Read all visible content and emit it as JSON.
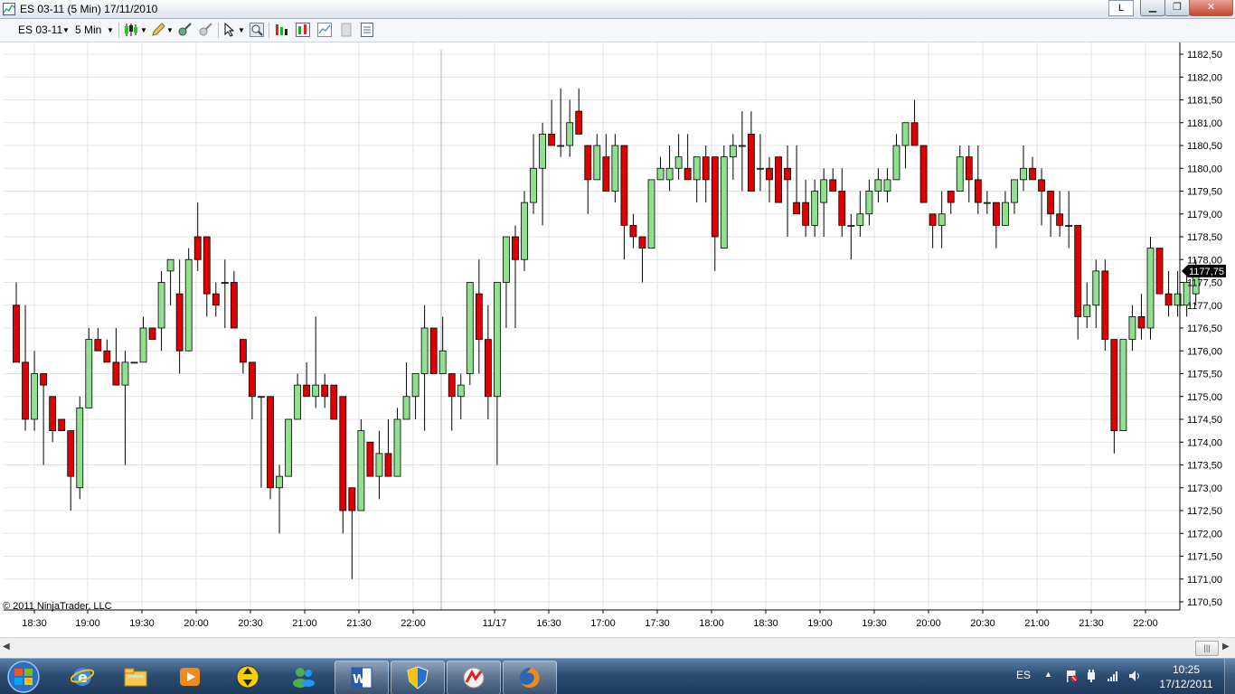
{
  "window": {
    "title": "ES 03-11 (5 Min)  17/11/2010",
    "layout_label": "L",
    "minimize": "▁",
    "maximize": "❐",
    "close": "✕"
  },
  "toolbar": {
    "instrument": "ES 03-11",
    "interval": "5 Min",
    "icons": [
      "candlestick-icon",
      "pencil-icon",
      "crosshair-icon",
      "zoom-icon",
      "pointer-icon",
      "magnifier-icon",
      "strategy-icon",
      "indicators-icon",
      "data-box-icon",
      "properties-icon",
      "templates-icon"
    ]
  },
  "chart_data": {
    "type": "candlestick",
    "instrument": "ES 03-11",
    "interval": "5 Min",
    "colors": {
      "up": "#90e090",
      "down": "#e00000",
      "grid": "#e3e3e3",
      "wick": "#000000",
      "price_marker": "#000000"
    },
    "y_range": [
      1170.25,
      1182.75
    ],
    "y_ticks": [
      "1182,50",
      "1182,00",
      "1181,50",
      "1181,00",
      "1180,50",
      "1180,00",
      "1179,50",
      "1179,00",
      "1178,50",
      "1178,00",
      "1177,50",
      "1177,00",
      "1176,50",
      "1176,00",
      "1175,50",
      "1175,00",
      "1174,50",
      "1174,00",
      "1173,50",
      "1173,00",
      "1172,50",
      "1172,00",
      "1171,50",
      "1171,00",
      "1170,50"
    ],
    "x_labels": [
      "18:30",
      "19:00",
      "19:30",
      "20:00",
      "20:30",
      "21:00",
      "21:30",
      "22:00",
      "11/17",
      "16:30",
      "17:00",
      "17:30",
      "18:00",
      "18:30",
      "19:00",
      "19:30",
      "20:00",
      "20:30",
      "21:00",
      "21:30",
      "22:00"
    ],
    "session_break_label": "11/17",
    "last_price": "1177,75",
    "copyright": "© 2011 NinjaTrader, LLC",
    "bars": [
      [
        1177.0,
        1177.5,
        1175.75,
        1175.75
      ],
      [
        1175.75,
        1177.0,
        1174.25,
        1174.5
      ],
      [
        1174.5,
        1176.0,
        1174.25,
        1175.5
      ],
      [
        1175.5,
        1175.5,
        1173.5,
        1175.25
      ],
      [
        1175.0,
        1175.0,
        1174.0,
        1174.25
      ],
      [
        1174.5,
        1174.5,
        1174.25,
        1174.25
      ],
      [
        1174.25,
        1174.25,
        1172.5,
        1173.25
      ],
      [
        1173.0,
        1175.0,
        1172.75,
        1174.75
      ],
      [
        1174.75,
        1176.5,
        1174.75,
        1176.25
      ],
      [
        1176.25,
        1176.5,
        1176.0,
        1176.0
      ],
      [
        1176.0,
        1176.25,
        1175.75,
        1175.75
      ],
      [
        1175.75,
        1176.5,
        1175.25,
        1175.25
      ],
      [
        1175.25,
        1176.0,
        1173.5,
        1175.75
      ],
      [
        1175.75,
        1175.75,
        1175.75,
        1175.75
      ],
      [
        1175.75,
        1176.75,
        1175.75,
        1176.5
      ],
      [
        1176.5,
        1176.5,
        1176.25,
        1176.25
      ],
      [
        1176.5,
        1177.75,
        1176.0,
        1177.5
      ],
      [
        1177.75,
        1178.0,
        1177.0,
        1178.0
      ],
      [
        1177.25,
        1178.0,
        1175.5,
        1176.0
      ],
      [
        1176.0,
        1178.25,
        1176.0,
        1178.0
      ],
      [
        1178.5,
        1179.25,
        1177.75,
        1178.0
      ],
      [
        1178.5,
        1178.5,
        1176.75,
        1177.25
      ],
      [
        1177.25,
        1177.5,
        1176.75,
        1177.0
      ],
      [
        1177.5,
        1178.0,
        1176.5,
        1177.5
      ],
      [
        1177.5,
        1177.75,
        1176.5,
        1176.5
      ],
      [
        1176.25,
        1176.25,
        1175.5,
        1175.75
      ],
      [
        1175.75,
        1175.75,
        1174.5,
        1175.0
      ],
      [
        1175.0,
        1175.0,
        1173.0,
        1175.0
      ],
      [
        1175.0,
        1175.0,
        1172.75,
        1173.0
      ],
      [
        1173.0,
        1173.5,
        1172.0,
        1173.25
      ],
      [
        1173.25,
        1174.5,
        1173.25,
        1174.5
      ],
      [
        1174.5,
        1175.5,
        1174.5,
        1175.25
      ],
      [
        1175.25,
        1175.75,
        1175.0,
        1175.0
      ],
      [
        1175.0,
        1176.75,
        1174.75,
        1175.25
      ],
      [
        1175.25,
        1175.5,
        1174.75,
        1175.0
      ],
      [
        1175.25,
        1175.25,
        1174.5,
        1174.5
      ],
      [
        1175.0,
        1175.0,
        1172.0,
        1172.5
      ],
      [
        1173.0,
        1173.0,
        1171.0,
        1172.5
      ],
      [
        1172.5,
        1174.5,
        1172.5,
        1174.25
      ],
      [
        1174.0,
        1174.0,
        1173.25,
        1173.25
      ],
      [
        1173.25,
        1174.25,
        1172.75,
        1173.75
      ],
      [
        1173.75,
        1174.5,
        1173.25,
        1173.25
      ],
      [
        1173.25,
        1174.75,
        1173.25,
        1174.5
      ],
      [
        1174.5,
        1175.75,
        1174.5,
        1175.0
      ],
      [
        1175.0,
        1175.5,
        1174.5,
        1175.5
      ],
      [
        1175.5,
        1177.0,
        1174.25,
        1176.5
      ],
      [
        1176.5,
        1176.5,
        1175.5,
        1175.5
      ],
      [
        1175.5,
        1176.75,
        1175.5,
        1176.0
      ],
      [
        1175.5,
        1175.5,
        1174.25,
        1175.0
      ],
      [
        1175.0,
        1175.5,
        1174.5,
        1175.25
      ],
      [
        1175.5,
        1176.5,
        1175.25,
        1177.5
      ],
      [
        1177.25,
        1178.0,
        1175.5,
        1176.25
      ],
      [
        1176.25,
        1177.0,
        1174.5,
        1175.0
      ],
      [
        1175.0,
        1177.5,
        1173.5,
        1177.5
      ],
      [
        1177.5,
        1178.5,
        1176.5,
        1178.5
      ],
      [
        1178.5,
        1178.75,
        1176.5,
        1178.0
      ],
      [
        1178.0,
        1179.5,
        1177.75,
        1179.25
      ],
      [
        1179.25,
        1180.75,
        1179.0,
        1180.0
      ],
      [
        1180.0,
        1181.0,
        1178.75,
        1180.75
      ],
      [
        1180.75,
        1181.5,
        1180.5,
        1180.5
      ],
      [
        1180.5,
        1181.75,
        1180.25,
        1180.5
      ],
      [
        1180.5,
        1181.5,
        1180.25,
        1181.0
      ],
      [
        1181.25,
        1181.75,
        1180.75,
        1180.75
      ],
      [
        1180.5,
        1180.5,
        1179.0,
        1179.75
      ],
      [
        1179.75,
        1180.75,
        1179.75,
        1180.5
      ],
      [
        1180.25,
        1180.75,
        1179.5,
        1179.5
      ],
      [
        1179.5,
        1180.75,
        1179.25,
        1180.5
      ],
      [
        1180.5,
        1180.5,
        1178.0,
        1178.75
      ],
      [
        1178.75,
        1179.0,
        1178.25,
        1178.5
      ],
      [
        1178.5,
        1178.5,
        1177.5,
        1178.25
      ],
      [
        1178.25,
        1179.75,
        1178.25,
        1179.75
      ],
      [
        1179.75,
        1180.25,
        1179.75,
        1180.0
      ],
      [
        1179.75,
        1180.5,
        1179.5,
        1180.0
      ],
      [
        1180.0,
        1180.75,
        1179.75,
        1180.25
      ],
      [
        1180.0,
        1180.75,
        1179.75,
        1179.75
      ],
      [
        1179.75,
        1180.25,
        1179.25,
        1180.25
      ],
      [
        1180.25,
        1180.5,
        1179.25,
        1179.75
      ],
      [
        1180.25,
        1180.25,
        1177.75,
        1178.5
      ],
      [
        1178.25,
        1180.5,
        1178.25,
        1180.25
      ],
      [
        1180.25,
        1180.75,
        1179.75,
        1180.5
      ],
      [
        1180.5,
        1181.25,
        1179.5,
        1180.5
      ],
      [
        1180.75,
        1181.25,
        1179.5,
        1179.5
      ],
      [
        1180.0,
        1180.75,
        1179.5,
        1180.0
      ],
      [
        1180.0,
        1180.25,
        1179.25,
        1179.75
      ],
      [
        1180.25,
        1180.25,
        1179.25,
        1179.25
      ],
      [
        1180.0,
        1180.5,
        1178.5,
        1179.75
      ],
      [
        1179.25,
        1180.5,
        1179.0,
        1179.0
      ],
      [
        1179.25,
        1179.75,
        1178.5,
        1178.75
      ],
      [
        1178.75,
        1179.75,
        1178.5,
        1179.5
      ],
      [
        1179.25,
        1180.0,
        1178.5,
        1179.75
      ],
      [
        1179.75,
        1180.0,
        1179.5,
        1179.5
      ],
      [
        1179.5,
        1180.0,
        1178.5,
        1178.75
      ],
      [
        1178.75,
        1179.0,
        1178.0,
        1178.75
      ],
      [
        1178.75,
        1179.5,
        1178.5,
        1179.0
      ],
      [
        1179.0,
        1179.75,
        1178.75,
        1179.5
      ],
      [
        1179.5,
        1180.0,
        1179.25,
        1179.75
      ],
      [
        1179.5,
        1180.0,
        1179.25,
        1179.75
      ],
      [
        1179.75,
        1180.75,
        1179.75,
        1180.5
      ],
      [
        1180.5,
        1181.0,
        1180.0,
        1181.0
      ],
      [
        1181.0,
        1181.5,
        1180.5,
        1180.5
      ],
      [
        1180.5,
        1180.5,
        1179.25,
        1179.25
      ],
      [
        1179.0,
        1179.0,
        1178.25,
        1178.75
      ],
      [
        1178.75,
        1179.5,
        1178.25,
        1179.0
      ],
      [
        1179.5,
        1179.5,
        1179.0,
        1179.25
      ],
      [
        1179.5,
        1180.5,
        1179.5,
        1180.25
      ],
      [
        1180.25,
        1180.5,
        1179.25,
        1179.75
      ],
      [
        1179.75,
        1180.5,
        1179.0,
        1179.25
      ],
      [
        1179.25,
        1179.5,
        1179.0,
        1179.25
      ],
      [
        1179.25,
        1179.25,
        1178.25,
        1178.75
      ],
      [
        1178.75,
        1179.5,
        1178.75,
        1179.25
      ],
      [
        1179.25,
        1179.75,
        1179.0,
        1179.75
      ],
      [
        1179.75,
        1180.5,
        1179.5,
        1180.0
      ],
      [
        1180.0,
        1180.25,
        1179.75,
        1179.75
      ],
      [
        1179.75,
        1180.0,
        1178.75,
        1179.5
      ],
      [
        1179.5,
        1179.5,
        1178.5,
        1179.0
      ],
      [
        1179.0,
        1179.5,
        1178.5,
        1178.75
      ],
      [
        1178.75,
        1179.5,
        1178.25,
        1178.75
      ],
      [
        1178.75,
        1178.75,
        1176.25,
        1176.75
      ],
      [
        1176.75,
        1177.5,
        1176.5,
        1177.0
      ],
      [
        1177.0,
        1178.0,
        1176.5,
        1177.75
      ],
      [
        1177.75,
        1178.0,
        1176.0,
        1176.25
      ],
      [
        1176.25,
        1176.25,
        1173.75,
        1174.25
      ],
      [
        1174.25,
        1176.25,
        1174.25,
        1176.25
      ],
      [
        1176.25,
        1177.0,
        1176.0,
        1176.75
      ],
      [
        1176.75,
        1177.25,
        1176.25,
        1176.5
      ],
      [
        1176.5,
        1178.5,
        1176.25,
        1178.25
      ],
      [
        1178.25,
        1178.25,
        1177.5,
        1177.25
      ],
      [
        1177.25,
        1177.75,
        1176.75,
        1177.0
      ],
      [
        1177.0,
        1177.75,
        1176.75,
        1177.25
      ],
      [
        1177.0,
        1177.75,
        1176.75,
        1177.5
      ],
      [
        1177.25,
        1178.0,
        1177.0,
        1177.75
      ]
    ]
  },
  "taskbar": {
    "language": "ES",
    "tray_arrow": "▲",
    "time": "10:25",
    "date": "17/12/2011",
    "apps": [
      {
        "name": "internet-explorer",
        "active": false
      },
      {
        "name": "file-explorer",
        "active": false
      },
      {
        "name": "media-player",
        "active": false
      },
      {
        "name": "ninjatrader-launcher",
        "active": false
      },
      {
        "name": "messenger",
        "active": false
      },
      {
        "name": "word",
        "active": true
      },
      {
        "name": "security-shield",
        "active": true
      },
      {
        "name": "ninjatrader",
        "active": true
      },
      {
        "name": "firefox",
        "active": true
      }
    ]
  }
}
